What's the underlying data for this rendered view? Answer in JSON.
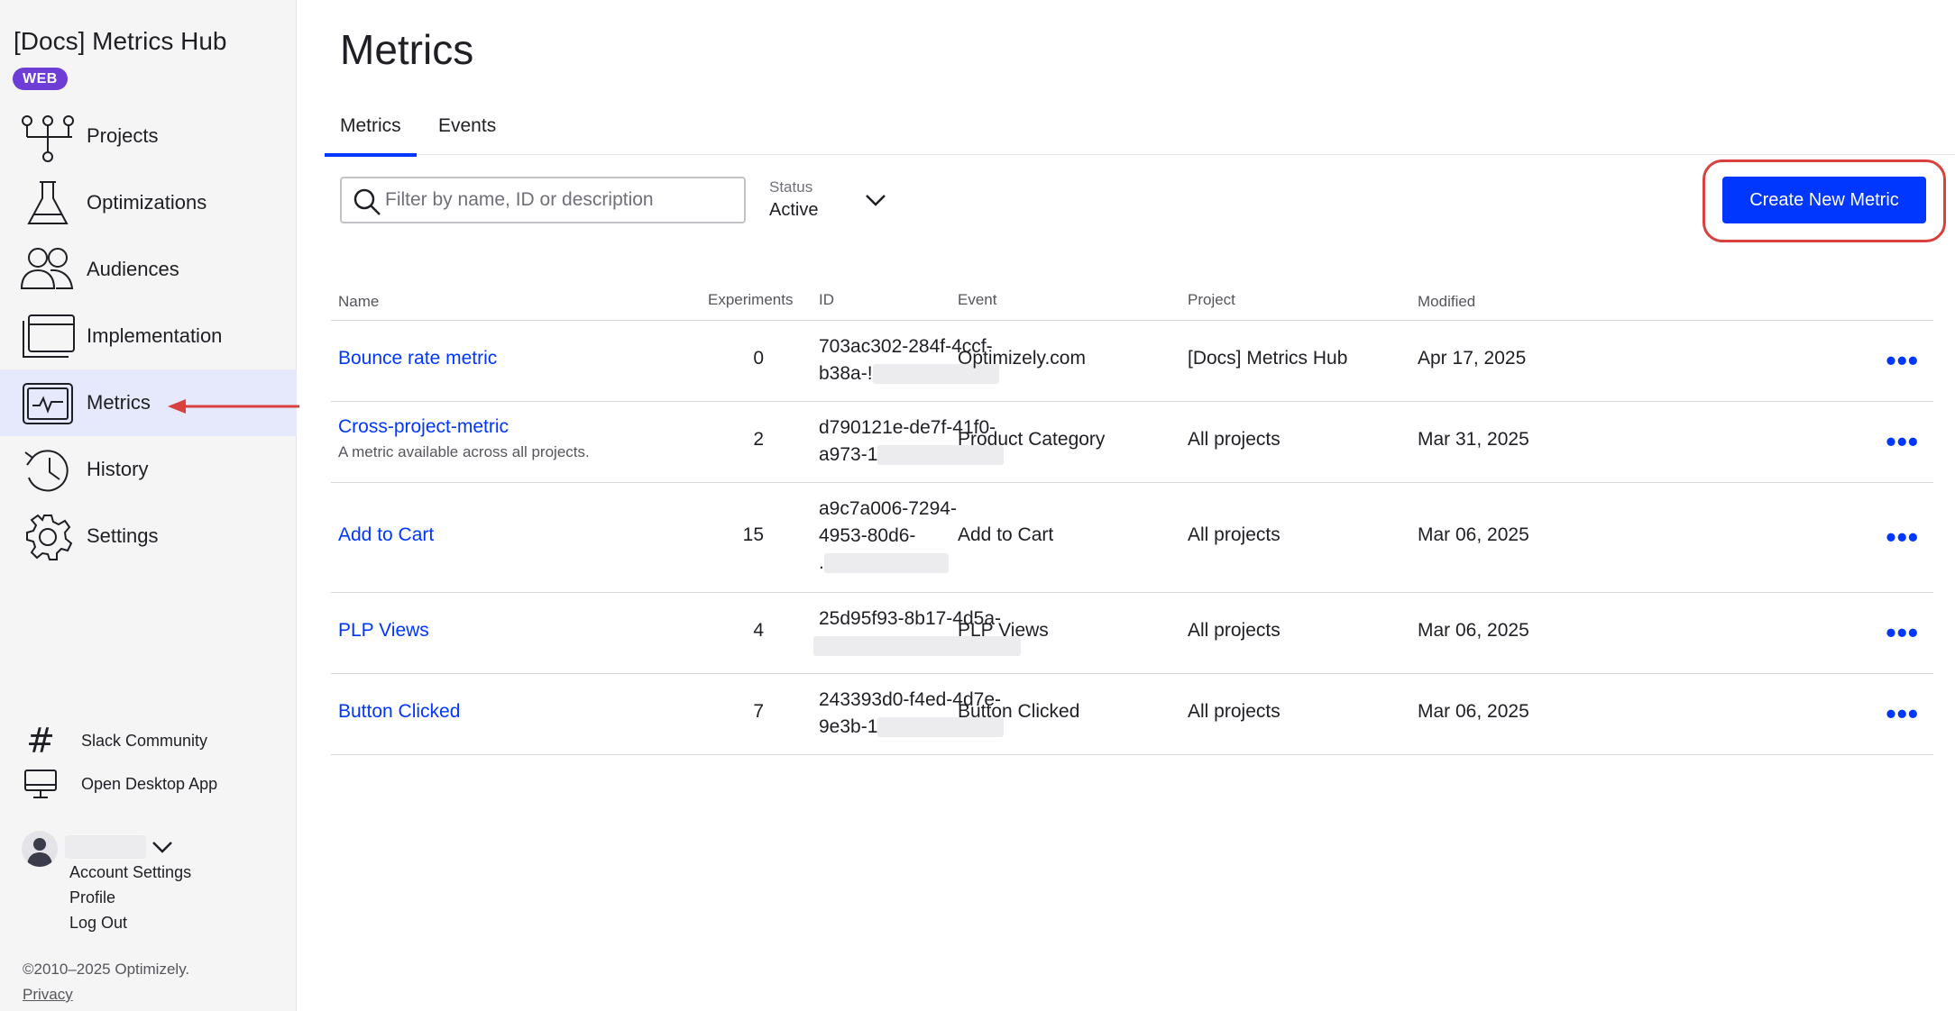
{
  "app": {
    "title": "[Docs] Metrics Hub",
    "badge": "WEB"
  },
  "sidebar": {
    "items": [
      {
        "label": "Projects",
        "icon": "projects-icon"
      },
      {
        "label": "Optimizations",
        "icon": "flask-icon"
      },
      {
        "label": "Audiences",
        "icon": "audiences-icon"
      },
      {
        "label": "Implementation",
        "icon": "browser-window-icon"
      },
      {
        "label": "Metrics",
        "icon": "metrics-icon",
        "active": true
      },
      {
        "label": "History",
        "icon": "history-icon"
      },
      {
        "label": "Settings",
        "icon": "gear-icon"
      }
    ],
    "footer": {
      "slack": "Slack Community",
      "desktop": "Open Desktop App",
      "account": [
        "Account Settings",
        "Profile",
        "Log Out"
      ],
      "copyright": "©2010–2025 Optimizely.",
      "privacy": "Privacy"
    }
  },
  "main": {
    "title": "Metrics",
    "tabs": [
      "Metrics",
      "Events"
    ],
    "search_placeholder": "Filter by name, ID or description",
    "status_label": "Status",
    "status_value": "Active",
    "create_button": "Create New Metric",
    "columns": [
      "Name",
      "Experiments",
      "ID",
      "Event",
      "Project",
      "Modified"
    ],
    "rows": [
      {
        "name": "Bounce rate metric",
        "description": "",
        "experiments": "0",
        "id_lines": [
          "703ac302-284f-4ccf-",
          "b38a-!"
        ],
        "event": "Optimizely.com",
        "project": "[Docs] Metrics Hub",
        "modified": "Apr 17, 2025"
      },
      {
        "name": "Cross-project-metric",
        "description": "A metric available across all projects.",
        "experiments": "2",
        "id_lines": [
          "d790121e-de7f-41f0-",
          "a973-1"
        ],
        "event": "Product Category",
        "project": "All projects",
        "modified": "Mar 31, 2025"
      },
      {
        "name": "Add to Cart",
        "description": "",
        "experiments": "15",
        "id_lines": [
          "a9c7a006-7294-",
          "4953-80d6-",
          "."
        ],
        "event": "Add to Cart",
        "project": "All projects",
        "modified": "Mar 06, 2025"
      },
      {
        "name": "PLP Views",
        "description": "",
        "experiments": "4",
        "id_lines": [
          "25d95f93-8b17-4d5a-",
          ""
        ],
        "event": "PLP Views",
        "project": "All projects",
        "modified": "Mar 06, 2025"
      },
      {
        "name": "Button Clicked",
        "description": "",
        "experiments": "7",
        "id_lines": [
          "243393d0-f4ed-4d7e-",
          "9e3b-1"
        ],
        "event": "Button Clicked",
        "project": "All projects",
        "modified": "Mar 06, 2025"
      }
    ]
  },
  "colors": {
    "accent": "#0037ff",
    "badge": "#6d3dd6",
    "highlight_ring": "#d9413f",
    "active_nav": "#e6e8fb"
  }
}
